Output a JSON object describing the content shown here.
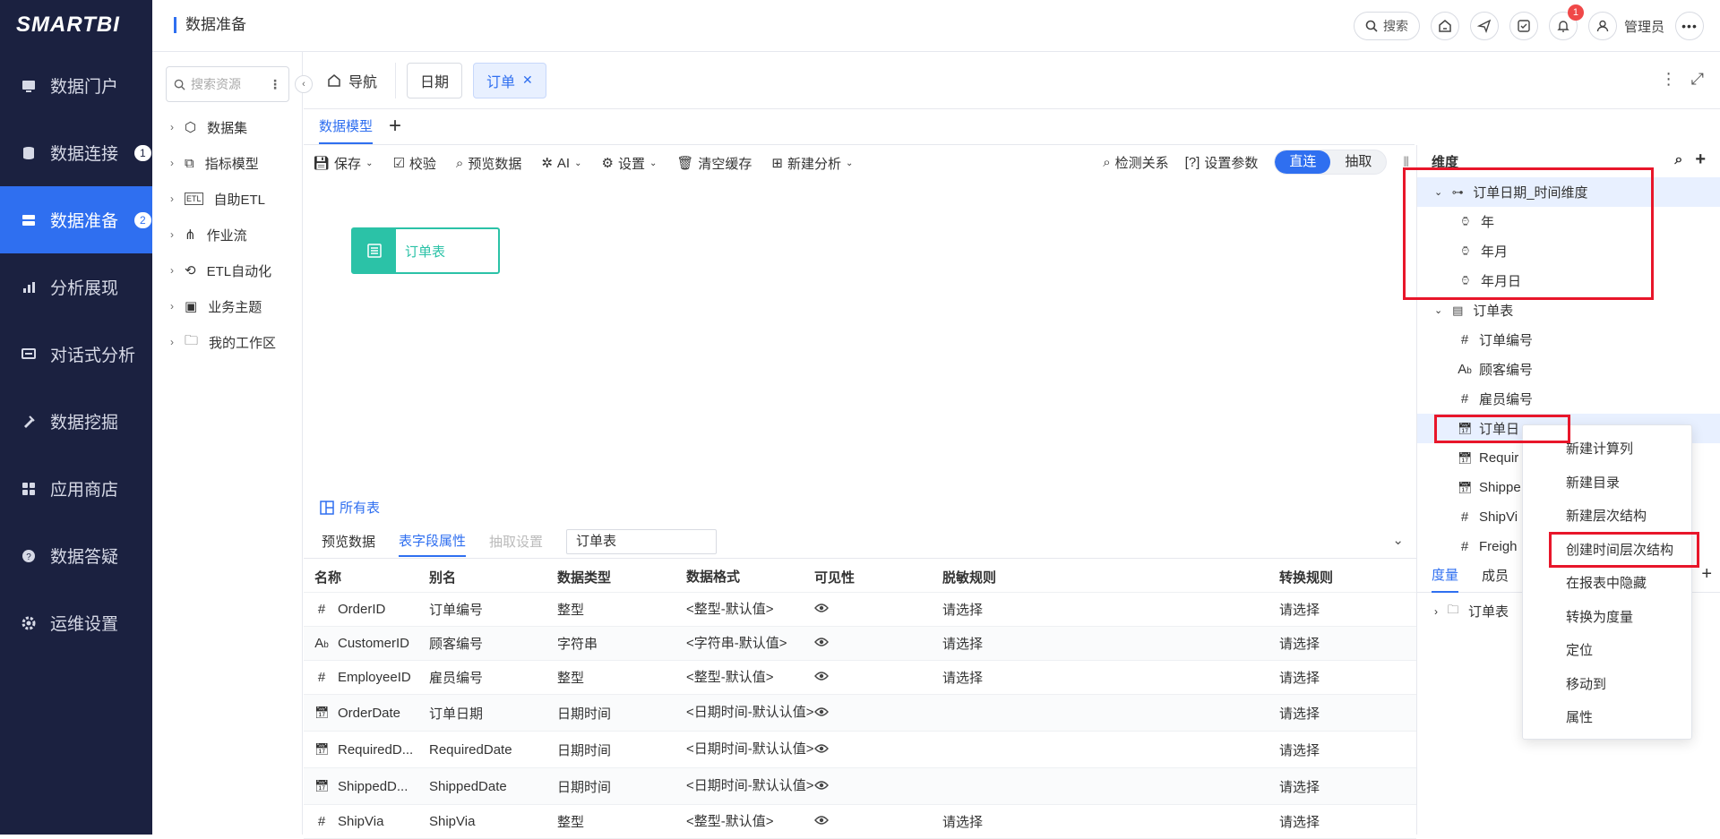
{
  "app": {
    "logo": "SMARTBI",
    "page_title": "数据准备"
  },
  "topbar": {
    "search_label": "搜索",
    "notification_count": "1",
    "user_name": "管理员"
  },
  "sidebar": {
    "items": [
      {
        "label": "数据门户",
        "count": ""
      },
      {
        "label": "数据连接",
        "count": "1"
      },
      {
        "label": "数据准备",
        "count": "2"
      },
      {
        "label": "分析展现",
        "count": ""
      },
      {
        "label": "对话式分析",
        "count": ""
      },
      {
        "label": "数据挖掘",
        "count": ""
      },
      {
        "label": "应用商店",
        "count": ""
      },
      {
        "label": "数据答疑",
        "count": ""
      },
      {
        "label": "运维设置",
        "count": ""
      }
    ]
  },
  "resources": {
    "search_placeholder": "搜索资源",
    "items": [
      "数据集",
      "指标模型",
      "自助ETL",
      "作业流",
      "ETL自动化",
      "业务主题",
      "我的工作区"
    ]
  },
  "tabs": {
    "home": "导航",
    "items": [
      "日期",
      "订单"
    ]
  },
  "subtabs": {
    "active": "数据模型"
  },
  "toolbar": {
    "save": "保存",
    "validate": "校验",
    "preview": "预览数据",
    "ai": "AI",
    "settings": "设置",
    "clear_cache": "清空缓存",
    "new_analysis": "新建分析",
    "detect": "检测关系",
    "params": "设置参数",
    "mode_direct": "直连",
    "mode_extract": "抽取"
  },
  "canvas": {
    "node_label": "订单表",
    "all_tables": "所有表"
  },
  "bottom": {
    "tabs": [
      "预览数据",
      "表字段属性",
      "抽取设置"
    ],
    "table_name": "订单表",
    "columns": [
      "名称",
      "别名",
      "数据类型",
      "数据格式",
      "可见性",
      "脱敏规则",
      "转换规则"
    ],
    "rows": [
      {
        "icon": "#",
        "name": "OrderID",
        "alias": "订单编号",
        "type": "整型",
        "format": "<整型-默认值>",
        "mask": "请选择",
        "convert": "请选择"
      },
      {
        "icon": "Ab",
        "name": "CustomerID",
        "alias": "顾客编号",
        "type": "字符串",
        "format": "<字符串-默认值>",
        "mask": "请选择",
        "convert": "请选择"
      },
      {
        "icon": "#",
        "name": "EmployeeID",
        "alias": "雇员编号",
        "type": "整型",
        "format": "<整型-默认值>",
        "mask": "请选择",
        "convert": "请选择"
      },
      {
        "icon": "cal",
        "name": "OrderDate",
        "alias": "订单日期",
        "type": "日期时间",
        "format": "<日期时间-默认认值>",
        "mask": "",
        "convert": "请选择"
      },
      {
        "icon": "cal",
        "name": "RequiredD...",
        "alias": "RequiredDate",
        "type": "日期时间",
        "format": "<日期时间-默认认值>",
        "mask": "",
        "convert": "请选择"
      },
      {
        "icon": "cal",
        "name": "ShippedD...",
        "alias": "ShippedDate",
        "type": "日期时间",
        "format": "<日期时间-默认认值>",
        "mask": "",
        "convert": "请选择"
      },
      {
        "icon": "#",
        "name": "ShipVia",
        "alias": "ShipVia",
        "type": "整型",
        "format": "<整型-默认值>",
        "mask": "请选择",
        "convert": "请选择"
      }
    ]
  },
  "dimensions": {
    "title": "维度",
    "time_dim": "订单日期_时间维度",
    "time_levels": [
      "年",
      "年月",
      "年月日"
    ],
    "table": "订单表",
    "fields": [
      {
        "icon": "#",
        "label": "订单编号"
      },
      {
        "icon": "Ab",
        "label": "顾客编号"
      },
      {
        "icon": "#",
        "label": "雇员编号"
      },
      {
        "icon": "cal",
        "label": "订单日"
      },
      {
        "icon": "cal",
        "label": "Requir"
      },
      {
        "icon": "cal",
        "label": "Shippe"
      },
      {
        "icon": "#",
        "label": "ShipVi"
      },
      {
        "icon": "#",
        "label": "Freigh"
      }
    ]
  },
  "measures": {
    "tabs": [
      "度量",
      "成员"
    ],
    "folder": "订单表"
  },
  "context_menu": {
    "items": [
      "新建计算列",
      "新建目录",
      "新建层次结构",
      "创建时间层次结构",
      "在报表中隐藏",
      "转换为度量",
      "定位",
      "移动到",
      "属性"
    ]
  },
  "colors": {
    "accent": "#2f6ff0",
    "sidebar_bg": "#1b2140",
    "node_green": "#2bc2a7",
    "highlight_red": "#e8162a"
  }
}
